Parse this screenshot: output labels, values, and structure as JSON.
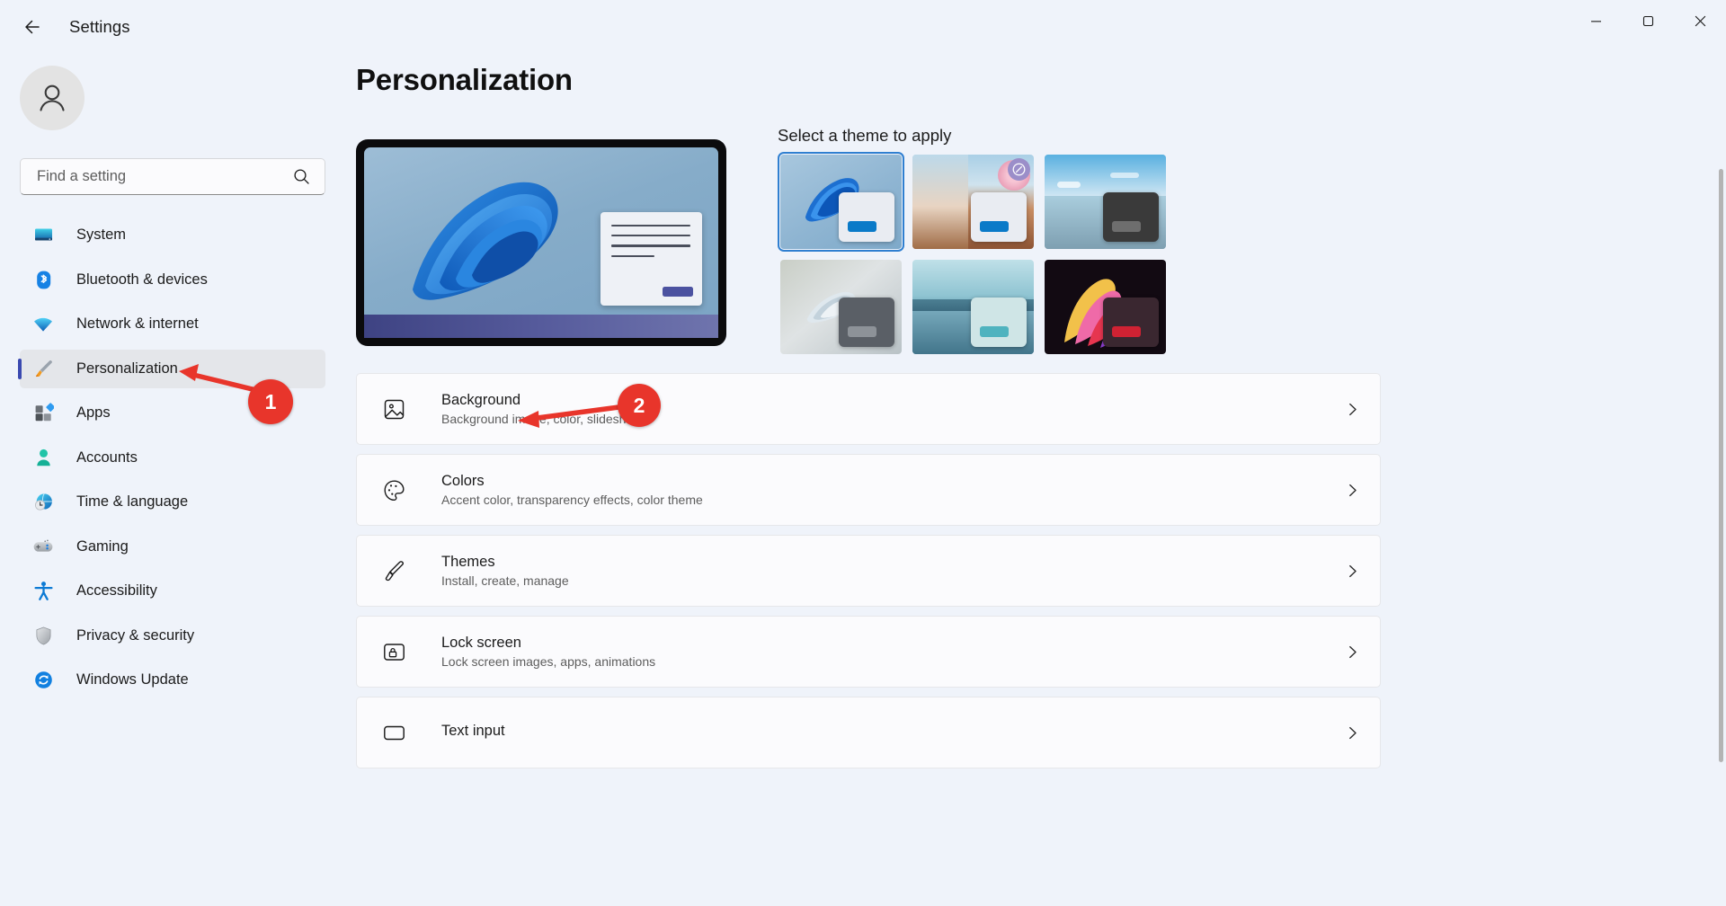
{
  "window": {
    "title": "Settings",
    "back_icon": "back-arrow-icon",
    "minimize_label": "Minimize",
    "maximize_label": "Maximize",
    "close_label": "Close"
  },
  "sidebar": {
    "avatar_icon": "person-avatar-icon",
    "search": {
      "placeholder": "Find a setting",
      "value": "",
      "icon": "search-icon"
    },
    "items": [
      {
        "label": "System",
        "icon": "monitor-icon",
        "active": false
      },
      {
        "label": "Bluetooth & devices",
        "icon": "bluetooth-icon",
        "active": false
      },
      {
        "label": "Network & internet",
        "icon": "wifi-icon",
        "active": false
      },
      {
        "label": "Personalization",
        "icon": "paintbrush-icon",
        "active": true
      },
      {
        "label": "Apps",
        "icon": "apps-grid-icon",
        "active": false
      },
      {
        "label": "Accounts",
        "icon": "person-icon",
        "active": false
      },
      {
        "label": "Time & language",
        "icon": "globe-clock-icon",
        "active": false
      },
      {
        "label": "Gaming",
        "icon": "gamepad-icon",
        "active": false
      },
      {
        "label": "Accessibility",
        "icon": "accessibility-person-icon",
        "active": false
      },
      {
        "label": "Privacy & security",
        "icon": "shield-icon",
        "active": false
      },
      {
        "label": "Windows Update",
        "icon": "refresh-sync-icon",
        "active": false
      }
    ]
  },
  "main": {
    "page_title": "Personalization",
    "preview": {
      "name": "desktop-preview",
      "wallpaper": "windows-bloom-wallpaper"
    },
    "themes": {
      "heading": "Select a theme to apply",
      "items": [
        {
          "name": "theme-light-bloom",
          "selected": true,
          "badge": false,
          "window_bg": "#e9ecf2",
          "accent": "#0a7ac8"
        },
        {
          "name": "theme-blossom",
          "selected": false,
          "badge": true,
          "window_bg": "#e9ecf2",
          "accent": "#0a7ac8"
        },
        {
          "name": "theme-beach",
          "selected": false,
          "badge": false,
          "window_bg": "#3a3a3a",
          "accent": "#6e6e6e"
        },
        {
          "name": "theme-flow-light",
          "selected": false,
          "badge": false,
          "window_bg": "#5a5f66",
          "accent": "#8d9298"
        },
        {
          "name": "theme-lake",
          "selected": false,
          "badge": false,
          "window_bg": "#cfe5e6",
          "accent": "#4fb3bf"
        },
        {
          "name": "theme-glow-dark",
          "selected": false,
          "badge": false,
          "window_bg": "#3a2730",
          "accent": "#cf2233"
        }
      ]
    },
    "rows": [
      {
        "title": "Background",
        "subtitle": "Background image, color, slideshow",
        "icon": "image-icon"
      },
      {
        "title": "Colors",
        "subtitle": "Accent color, transparency effects, color theme",
        "icon": "palette-icon"
      },
      {
        "title": "Themes",
        "subtitle": "Install, create, manage",
        "icon": "paintbrush-icon"
      },
      {
        "title": "Lock screen",
        "subtitle": "Lock screen images, apps, animations",
        "icon": "lock-screen-icon"
      },
      {
        "title": "Text input",
        "subtitle": "",
        "icon": "text-input-icon"
      }
    ]
  },
  "annotations": [
    {
      "number": "1",
      "target": "Personalization"
    },
    {
      "number": "2",
      "target": "Background"
    }
  ],
  "colors": {
    "accent": "#3a49b0",
    "annotation_red": "#e8352b",
    "page_bg": "#eff3fa",
    "card_bg": "#fbfbfd"
  }
}
